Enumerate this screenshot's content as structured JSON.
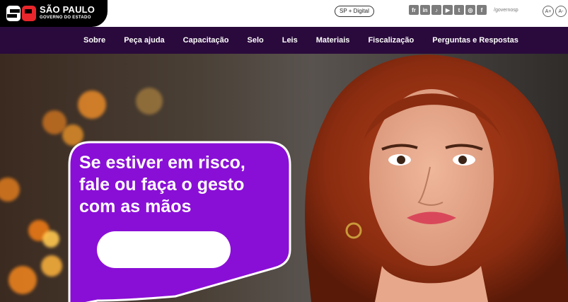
{
  "header": {
    "logo_title": "SÃO PAULO",
    "logo_subtitle": "GOVERNO DO ESTADO",
    "sp_digital_label": "SP + Digital",
    "socials": [
      {
        "icon": "flickr-icon",
        "glyph": "fr"
      },
      {
        "icon": "linkedin-icon",
        "glyph": "in"
      },
      {
        "icon": "tiktok-icon",
        "glyph": "♪"
      },
      {
        "icon": "youtube-icon",
        "glyph": "▶"
      },
      {
        "icon": "twitter-icon",
        "glyph": "t"
      },
      {
        "icon": "instagram-icon",
        "glyph": "◎"
      },
      {
        "icon": "facebook-icon",
        "glyph": "f"
      }
    ],
    "handle": "/governosp",
    "font_increase": "A+",
    "font_decrease": "A-"
  },
  "nav": {
    "items": [
      "Sobre",
      "Peça ajuda",
      "Capacitação",
      "Selo",
      "Leis",
      "Materiais",
      "Fiscalização",
      "Perguntas e Respostas"
    ]
  },
  "hero": {
    "headline_line1": "Se estiver em risco,",
    "headline_line2": "fale ou faça o gesto",
    "headline_line3": "com as mãos",
    "button_label": ""
  },
  "colors": {
    "brand_purple": "#8a0fd6",
    "nav_background": "#2a0a3c",
    "logo_red": "#e8262b"
  }
}
